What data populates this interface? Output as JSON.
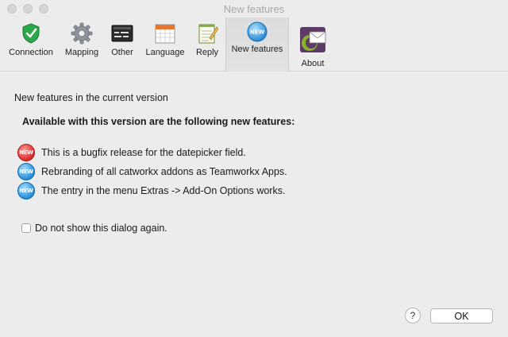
{
  "window": {
    "title": "New features"
  },
  "toolbar": {
    "items": [
      {
        "label": "Connection",
        "icon": "shield-check-icon"
      },
      {
        "label": "Mapping",
        "icon": "gear-icon"
      },
      {
        "label": "Other",
        "icon": "control-panel-icon"
      },
      {
        "label": "Language",
        "icon": "calendar-icon"
      },
      {
        "label": "Reply",
        "icon": "notepad-icon"
      },
      {
        "label": "New features",
        "icon": "new-badge-icon",
        "active": true
      },
      {
        "label": "About",
        "icon": "mail-logo-icon"
      }
    ]
  },
  "content": {
    "heading": "New features in the current version",
    "subheading": "Available with this version are the following new features:",
    "badge_text": "NEW",
    "features": [
      {
        "text": "This is a bugfix release for the datepicker field.",
        "badge_color": "#d22525"
      },
      {
        "text": "Rebranding of all catworkx addons as Teamworkx Apps.",
        "badge_color": "#1f86d1"
      },
      {
        "text": "The entry in the menu Extras -> Add-On Options works.",
        "badge_color": "#1f86d1"
      }
    ],
    "checkbox_label": "Do not show this dialog again.",
    "checkbox_checked": false
  },
  "buttons": {
    "help": "?",
    "ok": "OK"
  }
}
